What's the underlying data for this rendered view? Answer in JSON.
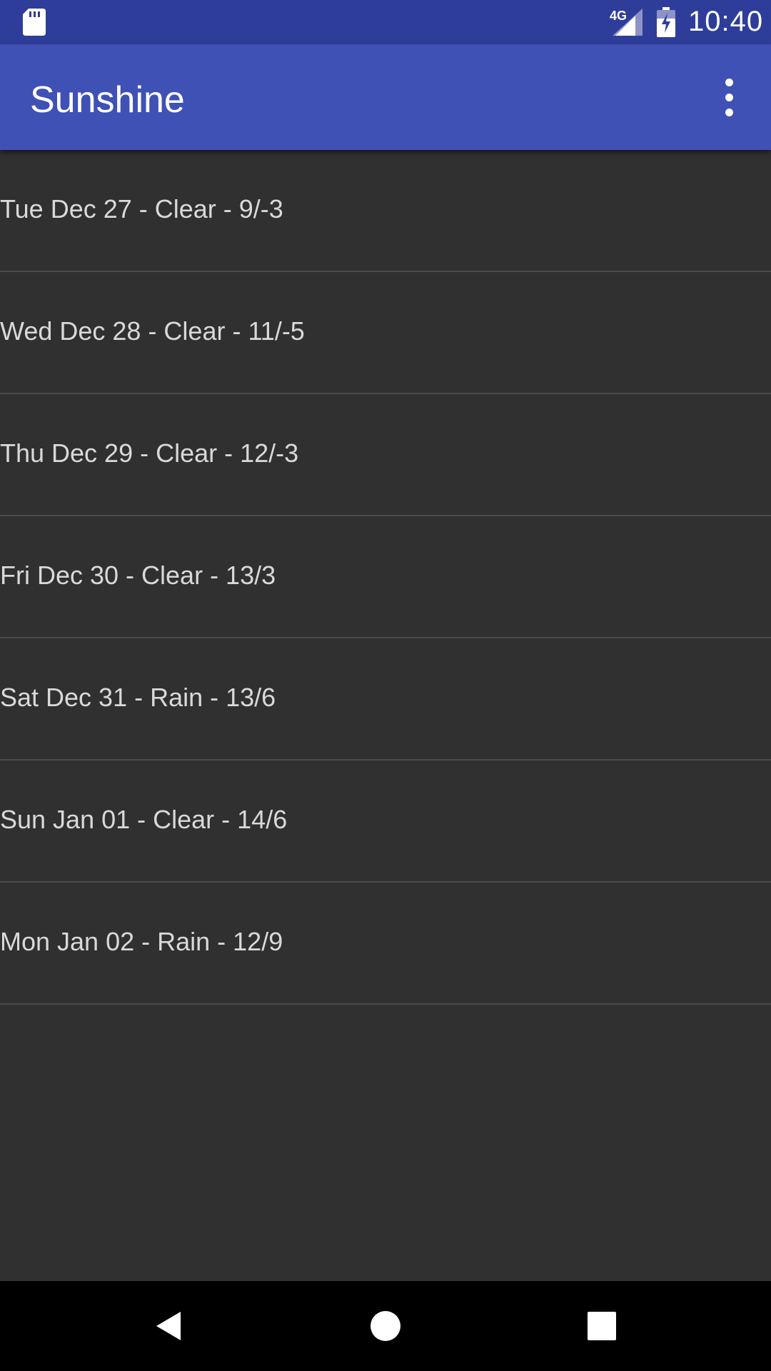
{
  "status_bar": {
    "network_type": "4G",
    "time": "10:40",
    "icons": [
      "sd-card-icon",
      "signal-icon",
      "battery-charging-icon"
    ]
  },
  "app_bar": {
    "title": "Sunshine",
    "menu_icon": "more-vert-icon"
  },
  "forecast": {
    "items": [
      "Tue Dec 27 - Clear - 9/-3",
      "Wed Dec 28 - Clear - 11/-5",
      "Thu Dec 29 - Clear - 12/-3",
      "Fri Dec 30 - Clear - 13/3",
      "Sat Dec 31 - Rain - 13/6",
      "Sun Jan 01 - Clear - 14/6",
      "Mon Jan 02 - Rain - 12/9"
    ]
  },
  "nav_bar": {
    "icons": [
      "back-icon",
      "home-icon",
      "recents-icon"
    ]
  },
  "colors": {
    "status_bar": "#2f3d9a",
    "app_bar": "#3f51b5",
    "background": "#303030",
    "divider": "#4a4a4a",
    "list_text": "#d9d9d9",
    "nav_bar": "#000000"
  }
}
